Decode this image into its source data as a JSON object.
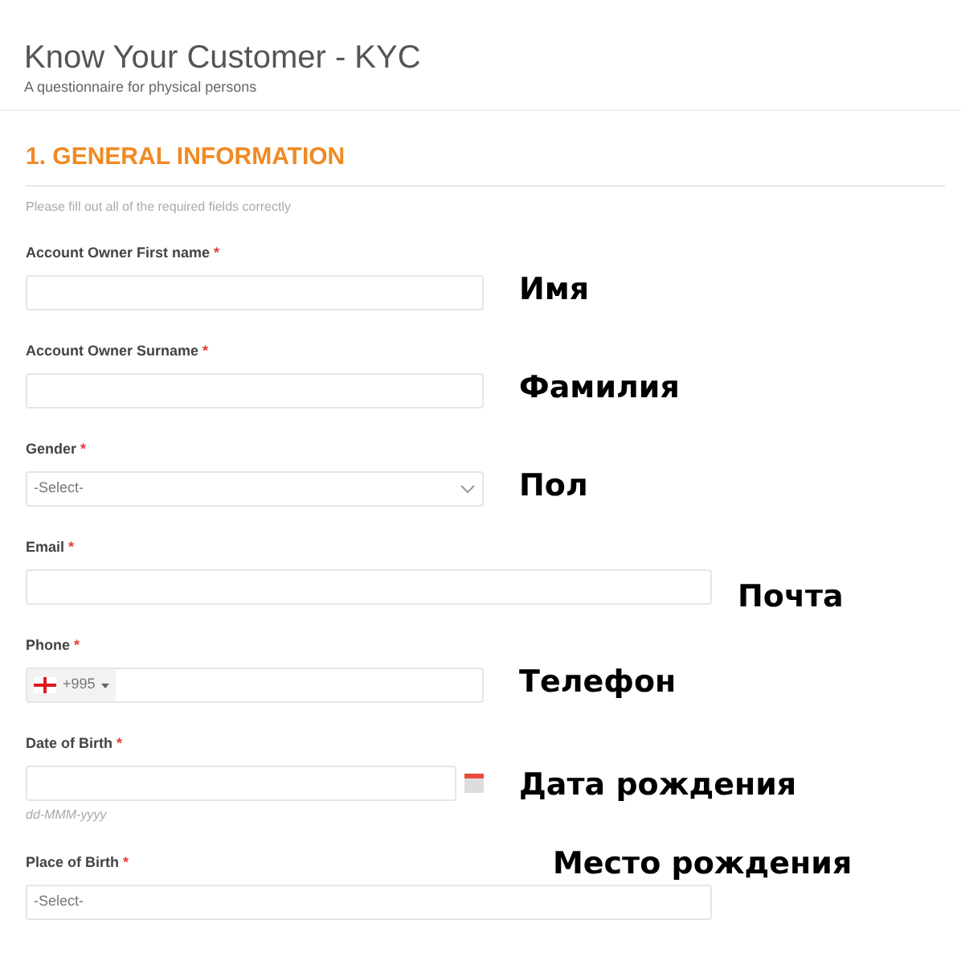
{
  "header": {
    "title": "Know Your Customer - KYC",
    "subtitle": "A questionnaire for physical persons"
  },
  "section": {
    "heading": "1. GENERAL INFORMATION",
    "note": "Please fill out all of the required fields correctly"
  },
  "fields": [
    {
      "kind": "text",
      "label": "Account Owner First name",
      "required_mark": "*",
      "annotation": "Имя",
      "wide": false
    },
    {
      "kind": "text",
      "label": "Account Owner Surname",
      "required_mark": "*",
      "annotation": "Фамилия",
      "wide": false
    },
    {
      "kind": "select",
      "label": "Gender",
      "required_mark": "*",
      "placeholder": "-Select-",
      "annotation": "Пол",
      "wide": false
    },
    {
      "kind": "text",
      "label": "Email",
      "required_mark": "*",
      "annotation": "Почта",
      "wide": true
    },
    {
      "kind": "phone",
      "label": "Phone",
      "required_mark": "*",
      "dial_code": "+995",
      "annotation": "Телефон",
      "wide": false
    },
    {
      "kind": "date",
      "label": "Date of Birth",
      "required_mark": "*",
      "hint": "dd-MMM-yyyy",
      "annotation": "Дата рождения",
      "wide": false
    },
    {
      "kind": "select_plain",
      "label": "Place of Birth",
      "required_mark": "*",
      "placeholder": "-Select-",
      "annotation": "Место рождения",
      "wide": true
    }
  ]
}
